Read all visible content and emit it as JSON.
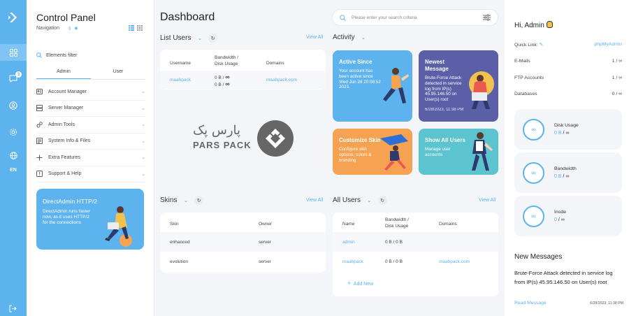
{
  "sidebar": {
    "title": "Control Panel",
    "nav_label": "Navigation",
    "filter_placeholder": "Elements filter",
    "tabs": [
      "Admin",
      "User"
    ],
    "items": [
      {
        "label": "Account Manager"
      },
      {
        "label": "Server Manager"
      },
      {
        "label": "Admin Tools"
      },
      {
        "label": "System Info & Files"
      },
      {
        "label": "Extra Features"
      },
      {
        "label": "Support & Help"
      }
    ],
    "promo": {
      "title": "DirectAdmin HTTP/2",
      "text": "DirectAdmin runs faster now, as it uses HTTP/2 for the connections"
    }
  },
  "rail": {
    "badge": "3",
    "lang": "EN"
  },
  "header": {
    "title": "Dashboard",
    "search_placeholder": "Please enter your search criteria"
  },
  "list_users": {
    "title": "List Users",
    "view_all": "View All",
    "columns": [
      "Username",
      "Bandwidth /\nDisk Usage",
      "Domains"
    ],
    "rows": [
      {
        "username": "maahpack",
        "bw": "0 B",
        "bw_limit": "∞",
        "disk": "0 B",
        "disk_limit": "∞",
        "domain": "maahpack.com"
      }
    ]
  },
  "activity": {
    "title": "Activity",
    "cards": [
      {
        "title": "Active Since",
        "text": "Your account has been active since Wed Jun 28 20:08:52 2023.",
        "color": "#5db3ee"
      },
      {
        "title": "Newest Message",
        "text": "Brute-Force Attack detected in service log from IP(s) 45.95.146.50 on User(s) root",
        "date": "6/28/2023, 11:38 PM",
        "color": "#5a5fa8"
      },
      {
        "title": "Customize Skin",
        "text": "Configure skin options, colors & branding",
        "color": "#f5a253"
      },
      {
        "title": "Show All Users",
        "text": "Manage user accounts",
        "color": "#5cc4cf"
      }
    ]
  },
  "watermark": {
    "latin": "PARS PACK",
    "persian": "پارس پک"
  },
  "skins": {
    "title": "Skins",
    "view_all": "View All",
    "columns": [
      "Skin",
      "Owner"
    ],
    "rows": [
      {
        "skin": "enhanced",
        "owner": "server"
      },
      {
        "skin": "evolution",
        "owner": "server"
      }
    ]
  },
  "all_users": {
    "title": "All Users",
    "view_all": "View All",
    "columns": [
      "Name",
      "Bandwidth /\nDisk Usage",
      "Domains"
    ],
    "rows": [
      {
        "name": "admin",
        "usage": "0 B / 0 B",
        "domain": ""
      },
      {
        "name": "maahpack",
        "usage": "0 B / 0 B",
        "domain": "maahpack.com"
      }
    ],
    "add_new": "Add New"
  },
  "right": {
    "greeting": "Hi, Admin",
    "quick_link_label": "Quick Link:",
    "quick_link": "phpMyAdmin",
    "emails": {
      "label": "E-Mails",
      "value": "1 / ∞"
    },
    "ftp": {
      "label": "FTP Accounts",
      "value": "1 / ∞"
    },
    "databases": {
      "label": "Databases",
      "value": "0 / ∞"
    },
    "stats": [
      {
        "label": "Disk Usage",
        "value": "0 B",
        "limit": "∞"
      },
      {
        "label": "Bandwidth",
        "value": "0 B",
        "limit": "∞"
      },
      {
        "label": "Inode",
        "value": "0",
        "limit": "∞"
      }
    ],
    "messages_title": "New Messages",
    "message_text": "Brute-Force Attack detected in service log from IP(s) 45.95.146.50 on User(s) root",
    "read_message": "Read Message",
    "message_date": "6/28/2023, 11:38 PM"
  },
  "colors": {
    "accent": "#5db3ee",
    "rail": "#5db3ee"
  }
}
